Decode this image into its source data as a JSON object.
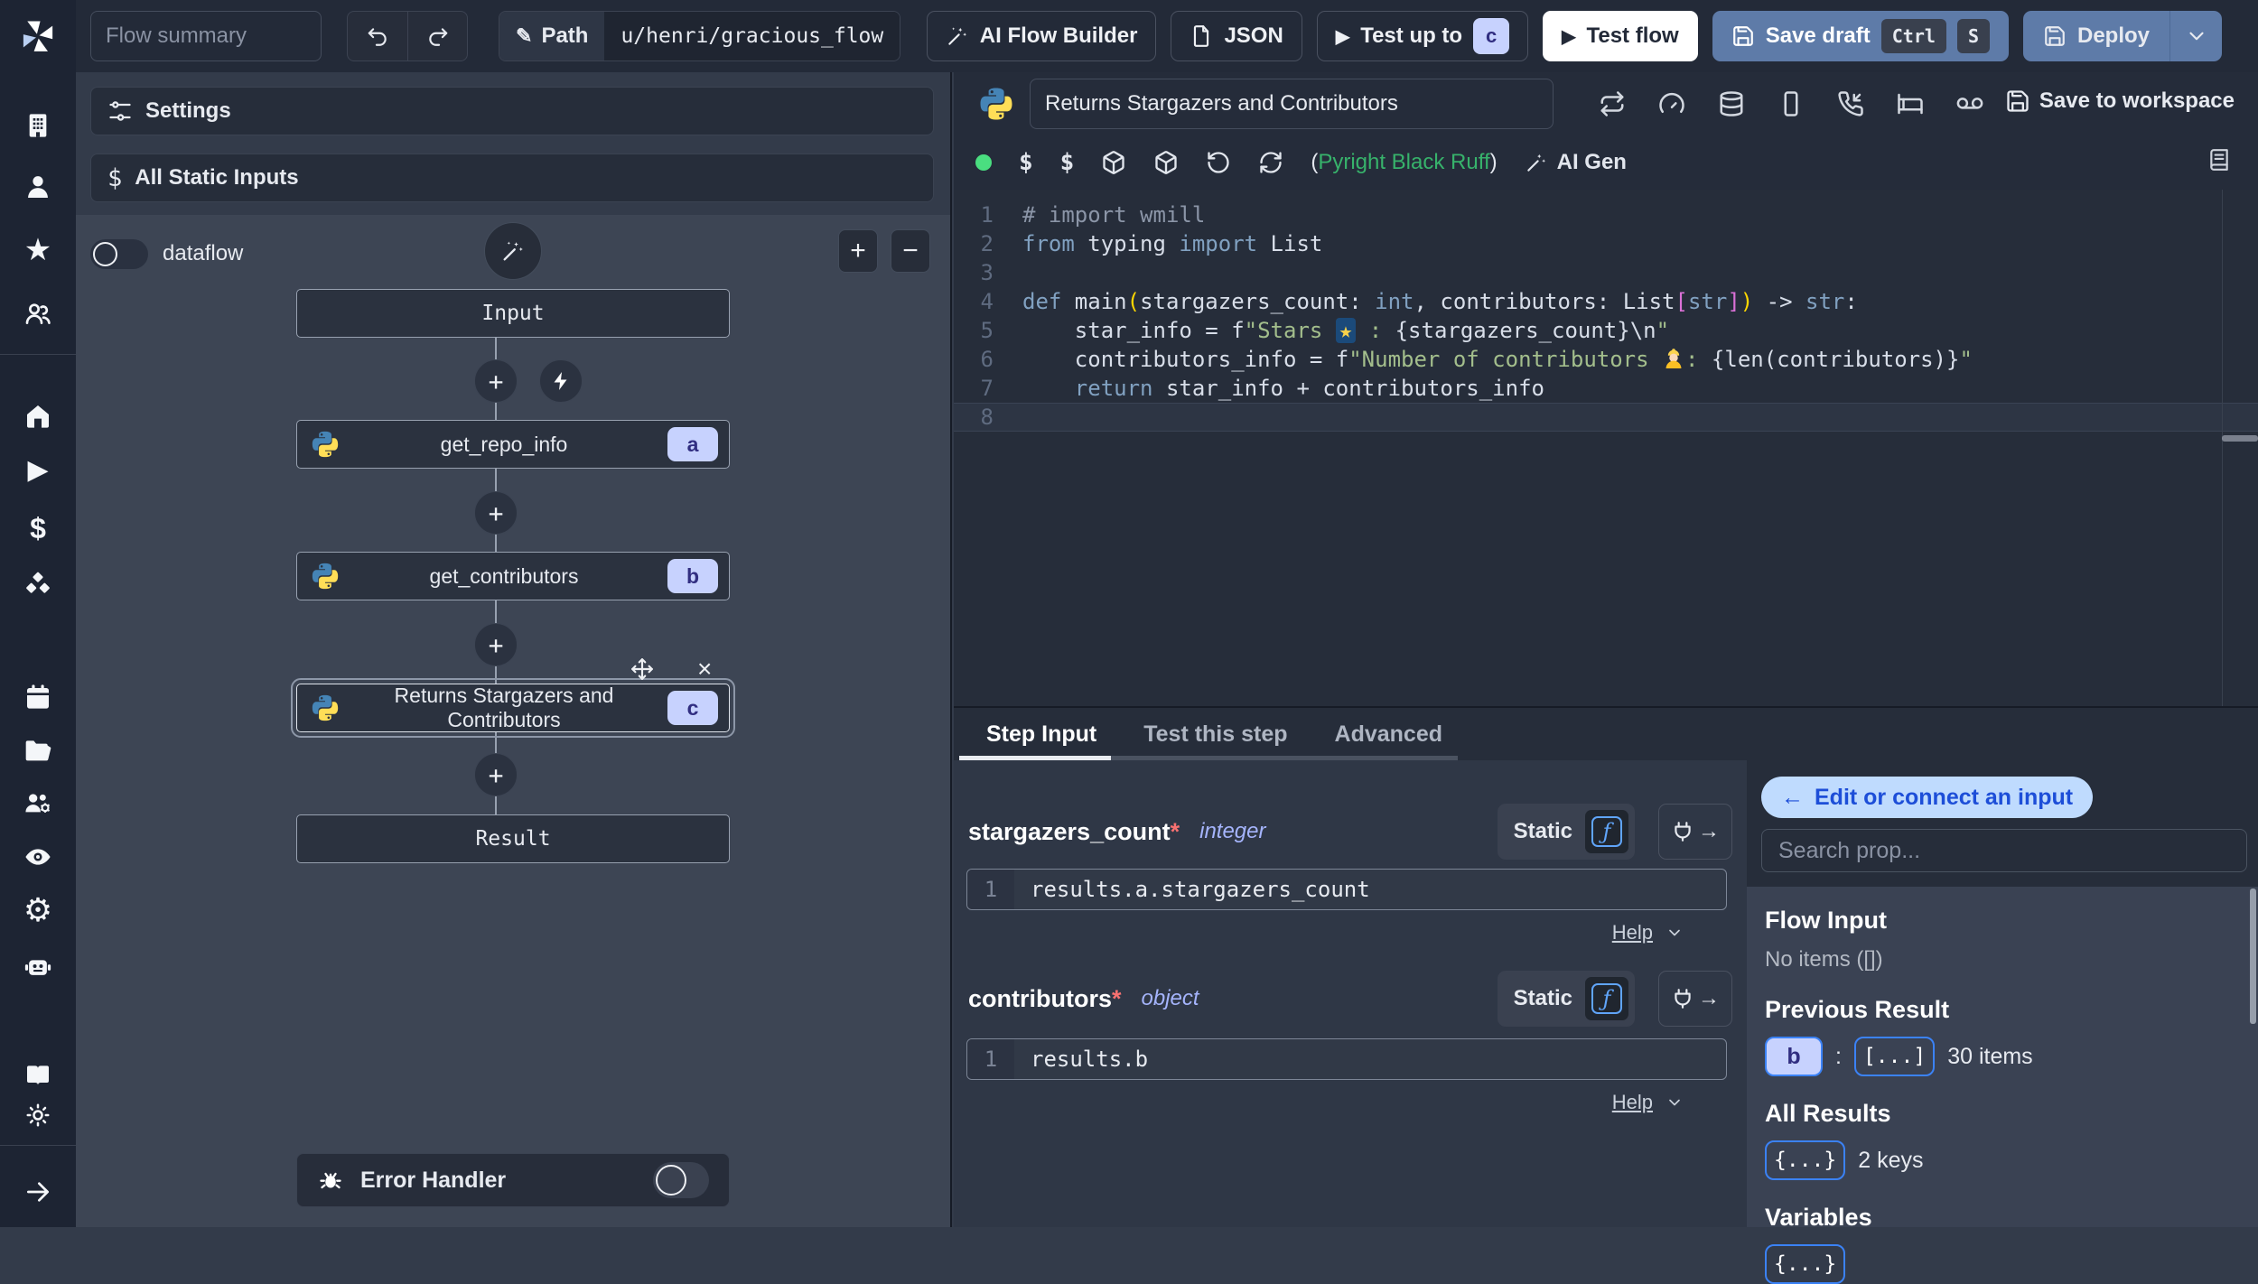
{
  "topbar": {
    "flow_summary_placeholder": "Flow summary",
    "path_label": "Path",
    "path_value": "u/henri/gracious_flow",
    "ai_flow_builder": "AI Flow Builder",
    "json_button": "JSON",
    "test_up_to": "Test up to",
    "test_up_to_badge": "c",
    "test_flow": "Test flow",
    "save_draft": "Save draft",
    "kbd_ctrl": "Ctrl",
    "kbd_s": "S",
    "deploy": "Deploy"
  },
  "flow_panel": {
    "settings": "Settings",
    "all_static_inputs": "All Static Inputs",
    "dataflow_label": "dataflow",
    "zoom_in": "+",
    "zoom_out": "−",
    "input_node": "Input",
    "steps": [
      {
        "label": "get_repo_info",
        "badge": "a"
      },
      {
        "label": "get_contributors",
        "badge": "b"
      },
      {
        "label": "Returns Stargazers and Contributors",
        "badge": "c"
      }
    ],
    "plus_glyph": "+",
    "result_node": "Result",
    "error_handler": "Error Handler"
  },
  "editor": {
    "title_value": "Returns Stargazers and Contributors",
    "save_to_workspace": "Save to workspace",
    "dollar1": "$",
    "dollar2": "$",
    "assist_open": "(",
    "assistants": "Pyright Black Ruff",
    "assist_close": ")",
    "ai_gen": "AI Gen"
  },
  "code": {
    "cursor_line": 8,
    "lines": [
      {
        "n": 1,
        "segs": [
          [
            "c-comment",
            "# import wmill"
          ]
        ]
      },
      {
        "n": 2,
        "segs": [
          [
            "c-kw",
            "from"
          ],
          [
            "c-plain",
            " typing "
          ],
          [
            "c-kw",
            "import"
          ],
          [
            "c-plain",
            " List"
          ]
        ]
      },
      {
        "n": 3,
        "segs": []
      },
      {
        "n": 4,
        "segs": [
          [
            "c-kw",
            "def"
          ],
          [
            "c-plain",
            " main"
          ],
          [
            "c-b1",
            "("
          ],
          [
            "c-plain",
            "stargazers_count: "
          ],
          [
            "c-type",
            "int"
          ],
          [
            "c-plain",
            ", contributors: List"
          ],
          [
            "c-b2",
            "["
          ],
          [
            "c-type",
            "str"
          ],
          [
            "c-b2",
            "]"
          ],
          [
            "c-b1",
            ")"
          ],
          [
            "c-plain",
            " -> "
          ],
          [
            "c-type",
            "str"
          ],
          [
            "c-plain",
            ":"
          ]
        ]
      },
      {
        "n": 5,
        "segs": [
          [
            "c-plain",
            "    star_info = f"
          ],
          [
            "c-str",
            "\"Stars "
          ],
          [
            "emoji-star",
            "★"
          ],
          [
            "c-str",
            " : "
          ],
          [
            "c-plain",
            "{stargazers_count}"
          ],
          [
            "c-esc",
            "\\n"
          ],
          [
            "c-str",
            "\""
          ]
        ]
      },
      {
        "n": 6,
        "segs": [
          [
            "c-plain",
            "    contributors_info = f"
          ],
          [
            "c-str",
            "\"Number of contributors "
          ],
          [
            "emoji-worker",
            ""
          ],
          [
            "c-str",
            ": "
          ],
          [
            "c-plain",
            "{len(contributors)}"
          ],
          [
            "c-str",
            "\""
          ]
        ]
      },
      {
        "n": 7,
        "segs": [
          [
            "c-plain",
            "    "
          ],
          [
            "c-kw",
            "return"
          ],
          [
            "c-plain",
            " star_info + contributors_info"
          ]
        ]
      },
      {
        "n": 8,
        "segs": []
      }
    ]
  },
  "step_panel": {
    "tabs": [
      {
        "label": "Step Input"
      },
      {
        "label": "Test this step"
      },
      {
        "label": "Advanced"
      }
    ],
    "fields": [
      {
        "name": "stargazers_count",
        "required": "*",
        "type": "integer",
        "mode": "Static",
        "fn_symbol": "ƒ",
        "line_no": "1",
        "expr": "results.a.stargazers_count",
        "help": "Help"
      },
      {
        "name": "contributors",
        "required": "*",
        "type": "object",
        "mode": "Static",
        "fn_symbol": "ƒ",
        "line_no": "1",
        "expr": "results.b",
        "help": "Help"
      }
    ]
  },
  "connect_panel": {
    "back_arrow": "←",
    "back_label": "Edit or connect an input",
    "search_placeholder": "Search prop...",
    "flow_input_title": "Flow Input",
    "flow_input_empty": "No items ([])",
    "previous_result_title": "Previous Result",
    "previous_result_badge": "b",
    "previous_result_sep": ":",
    "previous_result_array": "[...]",
    "previous_result_count": "30 items",
    "all_results_title": "All Results",
    "all_results_badge": "{...}",
    "all_results_count": "2 keys",
    "variables_title": "Variables",
    "variables_badge": "{...}"
  }
}
